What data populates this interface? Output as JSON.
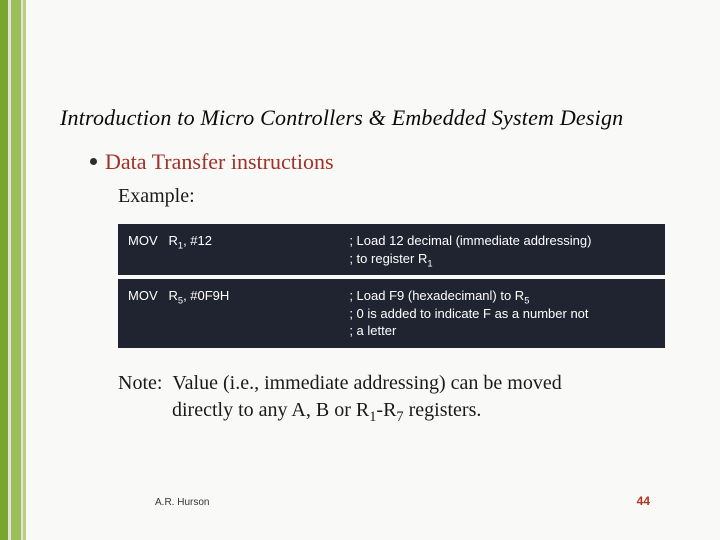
{
  "title": "Introduction to Micro Controllers & Embedded System Design",
  "bullet": "Data Transfer instructions",
  "exampleLabel": "Example:",
  "code": [
    {
      "mnemonic": "MOV",
      "args_pre": "R",
      "args_sub": "1",
      "args_post": ", #12",
      "comment_lines": [
        "; Load 12 decimal (immediate addressing)",
        "; to register R<sub>1</sub>"
      ]
    },
    {
      "mnemonic": "MOV",
      "args_pre": "R",
      "args_sub": "5",
      "args_post": ", #0F9H",
      "comment_lines": [
        "; Load F9 (hexadecimanl) to R<sub>5</sub>",
        "; 0 is added to indicate F as a number not",
        "; a letter"
      ]
    }
  ],
  "noteLine1": "Note:  Value (i.e., immediate addressing) can be moved",
  "noteLine2Pre": "directly to any A, B or R",
  "noteLine2Sub1": "1",
  "noteLine2Mid": "-R",
  "noteLine2Sub2": "7",
  "noteLine2Post": " registers.",
  "author": "A.R. Hurson",
  "page": "44"
}
